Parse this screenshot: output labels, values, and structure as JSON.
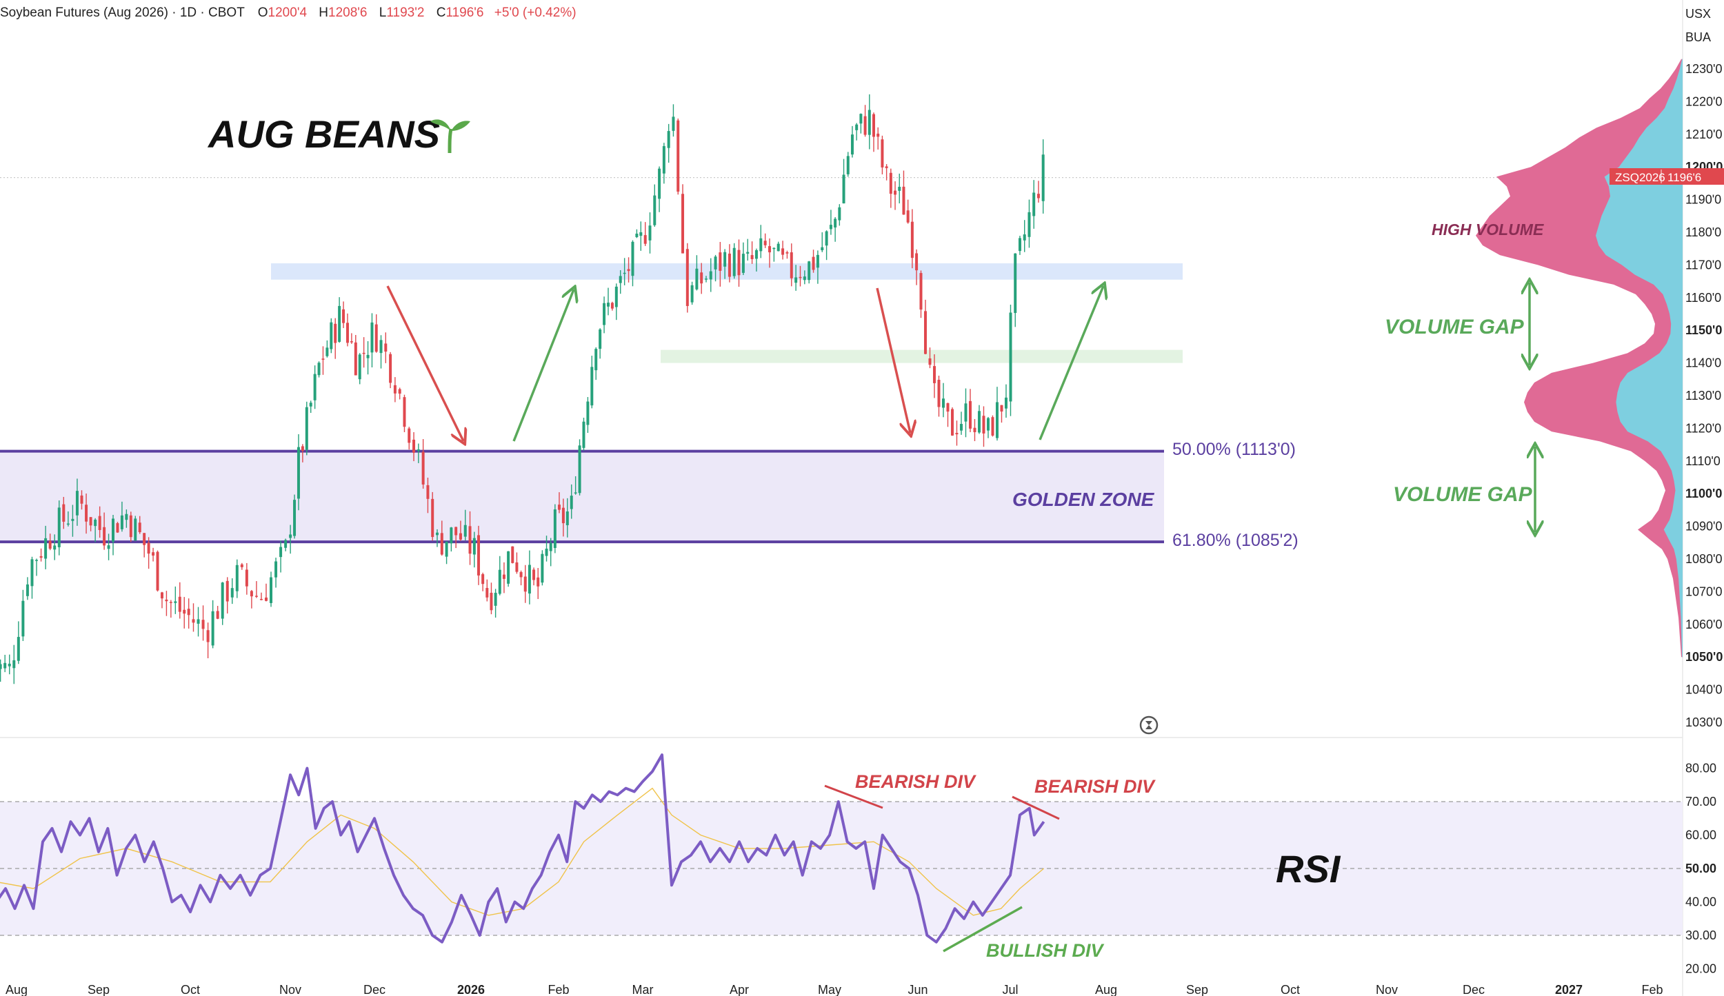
{
  "header": {
    "symbol_title": "Soybean Futures (Aug 2026) · 1D · CBOT",
    "o_label": "O",
    "o_value": "1200'4",
    "h_label": "H",
    "h_value": "1208'6",
    "l_label": "L",
    "l_value": "1193'2",
    "c_label": "C",
    "c_value": "1196'6",
    "change": "+5'0 (+0.42%)"
  },
  "currency": "USX",
  "unit_code": "BUA",
  "price_badge": {
    "ticker": "ZSQ2026",
    "price": "1196'6"
  },
  "colors": {
    "up": "#26a17b",
    "down": "#e0484e",
    "fib_line": "#5b3fa0",
    "golden_zone_fill": "#ece8f8",
    "rsi_line": "#7c5cc4",
    "rsi_ma": "#f0c34a",
    "rsi_band": "#f1eefb",
    "blue_zone": "#dbe7fb",
    "green_zone": "#e3f3e2",
    "vp_pink": "#e06a95",
    "vp_blue": "#7ecfe0",
    "arrow_red": "#d94f4f",
    "arrow_green": "#59a95a",
    "annot_red": "#d2444a",
    "annot_green": "#5cab50"
  },
  "annotations": {
    "title": "AUG BEANS",
    "sprout_icon": "seedling-icon",
    "golden_zone": "GOLDEN ZONE",
    "high_volume": "HIGH VOLUME",
    "volume_gap_1": "VOLUME GAP",
    "volume_gap_2": "VOLUME GAP",
    "fib50": "50.00% (1113'0)",
    "fib618": "61.80% (1085'2)",
    "rsi_label": "RSI",
    "bearish_div_1": "BEARISH DIV",
    "bearish_div_2": "BEARISH DIV",
    "bullish_div": "BULLISH DIV"
  },
  "chart_data": [
    {
      "type": "candlestick",
      "title": "Soybean Futures (Aug 2026) · 1D · CBOT",
      "ylim": [
        1025,
        1235
      ],
      "y_ticks": [
        {
          "v": 1230,
          "label": "1230'0",
          "bold": false
        },
        {
          "v": 1220,
          "label": "1220'0",
          "bold": false
        },
        {
          "v": 1210,
          "label": "1210'0",
          "bold": false
        },
        {
          "v": 1200,
          "label": "1200'0",
          "bold": true
        },
        {
          "v": 1190,
          "label": "1190'0",
          "bold": false
        },
        {
          "v": 1180,
          "label": "1180'0",
          "bold": false
        },
        {
          "v": 1170,
          "label": "1170'0",
          "bold": false
        },
        {
          "v": 1160,
          "label": "1160'0",
          "bold": false
        },
        {
          "v": 1150,
          "label": "1150'0",
          "bold": true
        },
        {
          "v": 1140,
          "label": "1140'0",
          "bold": false
        },
        {
          "v": 1130,
          "label": "1130'0",
          "bold": false
        },
        {
          "v": 1120,
          "label": "1120'0",
          "bold": false
        },
        {
          "v": 1110,
          "label": "1110'0",
          "bold": false
        },
        {
          "v": 1100,
          "label": "1100'0",
          "bold": true
        },
        {
          "v": 1090,
          "label": "1090'0",
          "bold": false
        },
        {
          "v": 1080,
          "label": "1080'0",
          "bold": false
        },
        {
          "v": 1070,
          "label": "1070'0",
          "bold": false
        },
        {
          "v": 1060,
          "label": "1060'0",
          "bold": false
        },
        {
          "v": 1050,
          "label": "1050'0",
          "bold": true
        },
        {
          "v": 1040,
          "label": "1040'0",
          "bold": false
        },
        {
          "v": 1030,
          "label": "1030'0",
          "bold": false
        }
      ],
      "x_labels": [
        {
          "label": "Aug",
          "bold": false
        },
        {
          "label": "Sep",
          "bold": false
        },
        {
          "label": "Oct",
          "bold": false
        },
        {
          "label": "Nov",
          "bold": false
        },
        {
          "label": "Dec",
          "bold": false
        },
        {
          "label": "2026",
          "bold": true
        },
        {
          "label": "Feb",
          "bold": false
        },
        {
          "label": "Mar",
          "bold": false
        },
        {
          "label": "Apr",
          "bold": false
        },
        {
          "label": "May",
          "bold": false
        },
        {
          "label": "Jun",
          "bold": false
        },
        {
          "label": "Jul",
          "bold": false
        },
        {
          "label": "Aug",
          "bold": false
        },
        {
          "label": "Sep",
          "bold": false
        },
        {
          "label": "Oct",
          "bold": false
        },
        {
          "label": "Nov",
          "bold": false
        },
        {
          "label": "Dec",
          "bold": false
        },
        {
          "label": "2027",
          "bold": true
        },
        {
          "label": "Feb",
          "bold": false
        }
      ],
      "close_path": [
        [
          -0.2,
          1048
        ],
        [
          0.05,
          1046
        ],
        [
          0.25,
          1078
        ],
        [
          0.55,
          1090
        ],
        [
          0.8,
          1097
        ],
        [
          1.05,
          1088
        ],
        [
          1.3,
          1094
        ],
        [
          1.55,
          1082
        ],
        [
          1.75,
          1067
        ],
        [
          2.0,
          1062
        ],
        [
          2.15,
          1058
        ],
        [
          2.45,
          1075
        ],
        [
          2.7,
          1068
        ],
        [
          2.95,
          1082
        ],
        [
          3.1,
          1110
        ],
        [
          3.35,
          1140
        ],
        [
          3.6,
          1155
        ],
        [
          3.8,
          1140
        ],
        [
          4.0,
          1150
        ],
        [
          4.2,
          1137
        ],
        [
          4.45,
          1110
        ],
        [
          4.65,
          1085
        ],
        [
          4.85,
          1088
        ],
        [
          5.05,
          1082
        ],
        [
          5.2,
          1068
        ],
        [
          5.45,
          1082
        ],
        [
          5.75,
          1070
        ],
        [
          5.95,
          1090
        ],
        [
          6.15,
          1095
        ],
        [
          6.25,
          1115
        ],
        [
          6.45,
          1150
        ],
        [
          6.75,
          1165
        ],
        [
          7.0,
          1178
        ],
        [
          7.2,
          1200
        ],
        [
          7.3,
          1222
        ],
        [
          7.45,
          1160
        ],
        [
          7.6,
          1165
        ],
        [
          7.85,
          1172
        ],
        [
          8.1,
          1170
        ],
        [
          8.3,
          1175
        ],
        [
          8.55,
          1168
        ],
        [
          8.8,
          1170
        ],
        [
          9.05,
          1182
        ],
        [
          9.25,
          1210
        ],
        [
          9.45,
          1215
        ],
        [
          9.65,
          1195
        ],
        [
          9.85,
          1188
        ],
        [
          10.0,
          1170
        ],
        [
          10.15,
          1130
        ],
        [
          10.35,
          1120
        ],
        [
          10.55,
          1125
        ],
        [
          10.75,
          1118
        ],
        [
          10.95,
          1130
        ],
        [
          11.05,
          1168
        ],
        [
          11.2,
          1185
        ],
        [
          11.35,
          1200
        ]
      ],
      "last_price": 1196.75,
      "fib_levels": [
        {
          "label": "50.00% (1113'0)",
          "price": 1113
        },
        {
          "label": "61.80% (1085'2)",
          "price": 1085.25
        }
      ],
      "zones": [
        {
          "name": "resistance-zone",
          "price_low": 1165.5,
          "price_high": 1170.5,
          "color": "#dbe7fb"
        },
        {
          "name": "support-zone",
          "price_low": 1140,
          "price_high": 1144,
          "color": "#e3f3e2"
        }
      ],
      "volume_profile": [
        [
          1233,
          2
        ],
        [
          1230,
          10
        ],
        [
          1227,
          20
        ],
        [
          1224,
          32
        ],
        [
          1221,
          48
        ],
        [
          1218,
          62
        ],
        [
          1215,
          90
        ],
        [
          1212,
          125
        ],
        [
          1209,
          150
        ],
        [
          1206,
          170
        ],
        [
          1203,
          195
        ],
        [
          1200,
          220
        ],
        [
          1197,
          270
        ],
        [
          1194,
          255
        ],
        [
          1191,
          250
        ],
        [
          1188,
          265
        ],
        [
          1185,
          280
        ],
        [
          1182,
          290
        ],
        [
          1179,
          300
        ],
        [
          1176,
          290
        ],
        [
          1173,
          265
        ],
        [
          1170,
          210
        ],
        [
          1167,
          165
        ],
        [
          1164,
          100
        ],
        [
          1161,
          68
        ],
        [
          1158,
          55
        ],
        [
          1155,
          45
        ],
        [
          1152,
          40
        ],
        [
          1149,
          42
        ],
        [
          1146,
          55
        ],
        [
          1143,
          80
        ],
        [
          1140,
          130
        ],
        [
          1137,
          190
        ],
        [
          1134,
          215
        ],
        [
          1131,
          225
        ],
        [
          1128,
          230
        ],
        [
          1125,
          225
        ],
        [
          1122,
          215
        ],
        [
          1119,
          190
        ],
        [
          1116,
          120
        ],
        [
          1113,
          75
        ],
        [
          1110,
          55
        ],
        [
          1107,
          38
        ],
        [
          1104,
          30
        ],
        [
          1101,
          25
        ],
        [
          1098,
          30
        ],
        [
          1095,
          35
        ],
        [
          1092,
          45
        ],
        [
          1089,
          65
        ],
        [
          1086,
          48
        ],
        [
          1083,
          30
        ],
        [
          1080,
          22
        ],
        [
          1077,
          18
        ],
        [
          1074,
          14
        ],
        [
          1071,
          12
        ],
        [
          1068,
          10
        ],
        [
          1065,
          8
        ],
        [
          1062,
          6
        ],
        [
          1059,
          5
        ],
        [
          1056,
          4
        ],
        [
          1053,
          3
        ],
        [
          1050,
          2
        ]
      ]
    },
    {
      "type": "line",
      "title": "RSI",
      "ylim": [
        17,
        85
      ],
      "y_ticks": [
        {
          "v": 80,
          "label": "80.00",
          "bold": false
        },
        {
          "v": 70,
          "label": "70.00",
          "bold": false
        },
        {
          "v": 60,
          "label": "60.00",
          "bold": false
        },
        {
          "v": 50,
          "label": "50.00",
          "bold": true
        },
        {
          "v": 40,
          "label": "40.00",
          "bold": false
        },
        {
          "v": 30,
          "label": "30.00",
          "bold": false
        },
        {
          "v": 20,
          "label": "20.00",
          "bold": false
        }
      ],
      "band": [
        30,
        70
      ],
      "mid": 50,
      "rsi": [
        [
          -0.1,
          40
        ],
        [
          0.0,
          44
        ],
        [
          0.1,
          38
        ],
        [
          0.2,
          45
        ],
        [
          0.3,
          38
        ],
        [
          0.4,
          58
        ],
        [
          0.5,
          62
        ],
        [
          0.6,
          55
        ],
        [
          0.7,
          64
        ],
        [
          0.8,
          60
        ],
        [
          0.9,
          65
        ],
        [
          1.0,
          55
        ],
        [
          1.1,
          62
        ],
        [
          1.2,
          48
        ],
        [
          1.3,
          56
        ],
        [
          1.4,
          60
        ],
        [
          1.5,
          52
        ],
        [
          1.6,
          58
        ],
        [
          1.7,
          50
        ],
        [
          1.8,
          40
        ],
        [
          1.9,
          42
        ],
        [
          2.0,
          37
        ],
        [
          2.1,
          45
        ],
        [
          2.2,
          40
        ],
        [
          2.3,
          48
        ],
        [
          2.4,
          44
        ],
        [
          2.5,
          48
        ],
        [
          2.6,
          42
        ],
        [
          2.7,
          48
        ],
        [
          2.8,
          50
        ],
        [
          2.9,
          64
        ],
        [
          3.0,
          78
        ],
        [
          3.1,
          72
        ],
        [
          3.2,
          80
        ],
        [
          3.3,
          62
        ],
        [
          3.4,
          68
        ],
        [
          3.5,
          70
        ],
        [
          3.6,
          60
        ],
        [
          3.7,
          64
        ],
        [
          3.8,
          55
        ],
        [
          3.9,
          60
        ],
        [
          4.0,
          65
        ],
        [
          4.1,
          56
        ],
        [
          4.2,
          48
        ],
        [
          4.3,
          42
        ],
        [
          4.4,
          38
        ],
        [
          4.5,
          36
        ],
        [
          4.6,
          30
        ],
        [
          4.7,
          28
        ],
        [
          4.8,
          34
        ],
        [
          4.9,
          42
        ],
        [
          5.0,
          36
        ],
        [
          5.1,
          30
        ],
        [
          5.2,
          40
        ],
        [
          5.3,
          44
        ],
        [
          5.4,
          34
        ],
        [
          5.5,
          40
        ],
        [
          5.6,
          38
        ],
        [
          5.7,
          44
        ],
        [
          5.8,
          48
        ],
        [
          5.9,
          55
        ],
        [
          6.0,
          60
        ],
        [
          6.1,
          52
        ],
        [
          6.2,
          70
        ],
        [
          6.3,
          68
        ],
        [
          6.4,
          72
        ],
        [
          6.5,
          70
        ],
        [
          6.6,
          73
        ],
        [
          6.7,
          72
        ],
        [
          6.8,
          74
        ],
        [
          6.9,
          73
        ],
        [
          7.0,
          76
        ],
        [
          7.1,
          79
        ],
        [
          7.2,
          84
        ],
        [
          7.3,
          45
        ],
        [
          7.4,
          52
        ],
        [
          7.5,
          54
        ],
        [
          7.6,
          58
        ],
        [
          7.7,
          52
        ],
        [
          7.8,
          56
        ],
        [
          7.9,
          52
        ],
        [
          8.0,
          58
        ],
        [
          8.1,
          52
        ],
        [
          8.2,
          56
        ],
        [
          8.3,
          54
        ],
        [
          8.4,
          60
        ],
        [
          8.5,
          54
        ],
        [
          8.6,
          58
        ],
        [
          8.7,
          48
        ],
        [
          8.8,
          58
        ],
        [
          8.9,
          56
        ],
        [
          9.0,
          60
        ],
        [
          9.1,
          70
        ],
        [
          9.2,
          58
        ],
        [
          9.3,
          56
        ],
        [
          9.4,
          58
        ],
        [
          9.5,
          44
        ],
        [
          9.6,
          60
        ],
        [
          9.7,
          56
        ],
        [
          9.8,
          52
        ],
        [
          9.9,
          50
        ],
        [
          10.0,
          42
        ],
        [
          10.1,
          30
        ],
        [
          10.2,
          28
        ],
        [
          10.3,
          32
        ],
        [
          10.4,
          38
        ],
        [
          10.5,
          35
        ],
        [
          10.6,
          40
        ],
        [
          10.7,
          36
        ],
        [
          10.8,
          40
        ],
        [
          10.9,
          44
        ],
        [
          11.0,
          48
        ],
        [
          11.1,
          66
        ],
        [
          11.2,
          68
        ],
        [
          11.25,
          60
        ],
        [
          11.35,
          64
        ]
      ],
      "rsi_ma": [
        [
          -0.1,
          46
        ],
        [
          0.3,
          44
        ],
        [
          0.8,
          53
        ],
        [
          1.3,
          56
        ],
        [
          1.8,
          52
        ],
        [
          2.3,
          46
        ],
        [
          2.8,
          46
        ],
        [
          3.2,
          58
        ],
        [
          3.6,
          66
        ],
        [
          4.0,
          62
        ],
        [
          4.4,
          52
        ],
        [
          4.8,
          40
        ],
        [
          5.2,
          36
        ],
        [
          5.6,
          38
        ],
        [
          6.0,
          46
        ],
        [
          6.3,
          58
        ],
        [
          6.7,
          66
        ],
        [
          7.1,
          74
        ],
        [
          7.3,
          66
        ],
        [
          7.6,
          60
        ],
        [
          8.0,
          56
        ],
        [
          8.5,
          56
        ],
        [
          9.0,
          57
        ],
        [
          9.5,
          58
        ],
        [
          9.9,
          52
        ],
        [
          10.2,
          44
        ],
        [
          10.6,
          36
        ],
        [
          10.9,
          38
        ],
        [
          11.1,
          44
        ],
        [
          11.35,
          50
        ]
      ]
    }
  ]
}
